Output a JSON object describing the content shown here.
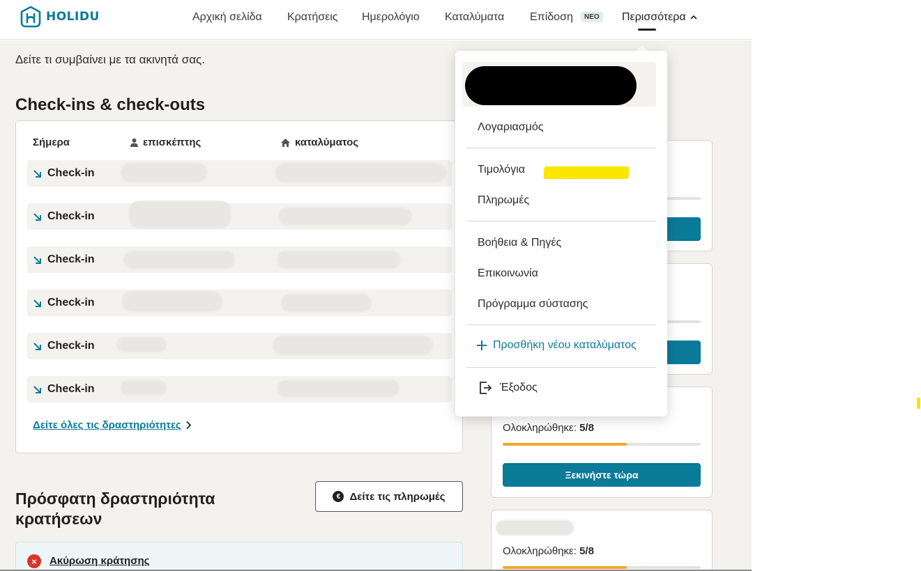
{
  "app": {
    "logo_text": "HOLIDU"
  },
  "nav": {
    "items": [
      "Αρχική σελίδα",
      "Κρατήσεις",
      "Ημερολόγιο",
      "Καταλύματα",
      "Επίδοση"
    ],
    "badge": "ΝΕΟ",
    "more": "Περισσότερα"
  },
  "main": {
    "subtitle": "Δείτε τι συμβαίνει με τα ακινητά σας.",
    "checkins": {
      "title": "Check-ins & check-outs",
      "columns": [
        "Σήμερα",
        "επισκέπτης",
        "καταλύματος"
      ],
      "rows": [
        "Check-in",
        "Check-in",
        "Check-in",
        "Check-in",
        "Check-in",
        "Check-in"
      ],
      "view_all": "Δείτε όλες τις δραστηριότητες"
    },
    "recent": {
      "title": "Πρόσφατη δραστηριότητα κρατήσεων",
      "payments_button": "Δείτε τις πληρωμές",
      "cancel_label": "Ακύρωση κράτησης"
    },
    "side": {
      "progress_label": "Ολοκληρώθηκε:",
      "progress_value": "5/8",
      "progress_fraction": 0.625,
      "start_button": "Ξεκινήστε τώρα"
    }
  },
  "dropdown": {
    "account": "Λογαριασμός",
    "invoices": "Τιμολόγια",
    "payments": "Πληρωμές",
    "help": "Βοήθεια & Πηγές",
    "contact": "Επικοινωνία",
    "referral": "Πρόγραμμα σύστασης",
    "add_property": "Προσθήκη νέου καταλύματος",
    "logout": "Έξοδος"
  },
  "colors": {
    "accent": "#0a7b99",
    "progress": "#f5a623",
    "cancel": "#d9352b",
    "highlight": "#fbe600"
  }
}
